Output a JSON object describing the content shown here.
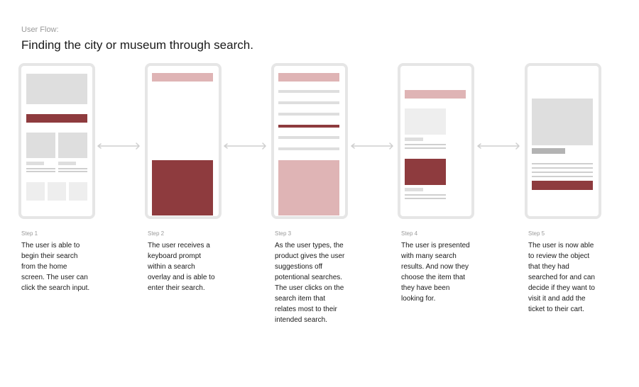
{
  "header": {
    "eyebrow": "User Flow:",
    "title": "Finding the city or museum through search."
  },
  "steps": [
    {
      "label": "Step 1",
      "desc": "The user is able to begin their search from the home screen. The user can click the search input."
    },
    {
      "label": "Step 2",
      "desc": "The user receives a keyboard prompt within a search overlay and is able to enter their search."
    },
    {
      "label": "Step 3",
      "desc": "As the user types, the product gives the user suggestions off potentional searches. The user clicks on the search item that relates most to their intended search."
    },
    {
      "label": "Step 4",
      "desc": "The user is presented with many search results. And now they choose the item that they have been looking for."
    },
    {
      "label": "Step 5",
      "desc": "The user is now able to review the object that they had searched for and can decide if they want to visit it and add the ticket to their cart."
    }
  ],
  "colors": {
    "accent": "#8e3b3e",
    "accent_light": "#dfb4b5",
    "placeholder": "#dedede",
    "frame": "#e6e6e6"
  }
}
